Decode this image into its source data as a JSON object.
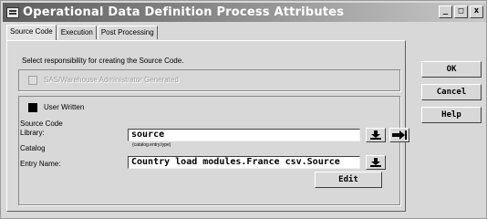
{
  "window": {
    "title": "Operational Data Definition Process Attributes",
    "controls": {
      "minimize": "_",
      "maximize": "□",
      "close": "x"
    }
  },
  "tabs": [
    {
      "label": "Source Code",
      "active": true
    },
    {
      "label": "Execution",
      "active": false
    },
    {
      "label": "Post Processing",
      "active": false
    }
  ],
  "source_code": {
    "prompt": "Select responsibility for creating the Source Code.",
    "option_disabled": {
      "label": "SAS/Warehouse Administrator Generated",
      "checked": false,
      "enabled": false
    },
    "option_user_written": {
      "label": "User Written",
      "checked": true
    },
    "section_label": "Source Code",
    "library": {
      "label": "Library:",
      "value": "source"
    },
    "catalog": {
      "label": "Catalog",
      "hint": "(catalog.entry.type)"
    },
    "entry_name": {
      "label": "Entry Name:",
      "value": "Country load modules.France csv.Source"
    },
    "edit_button": "Edit"
  },
  "side_buttons": {
    "ok": "OK",
    "cancel": "Cancel",
    "help": "Help"
  }
}
